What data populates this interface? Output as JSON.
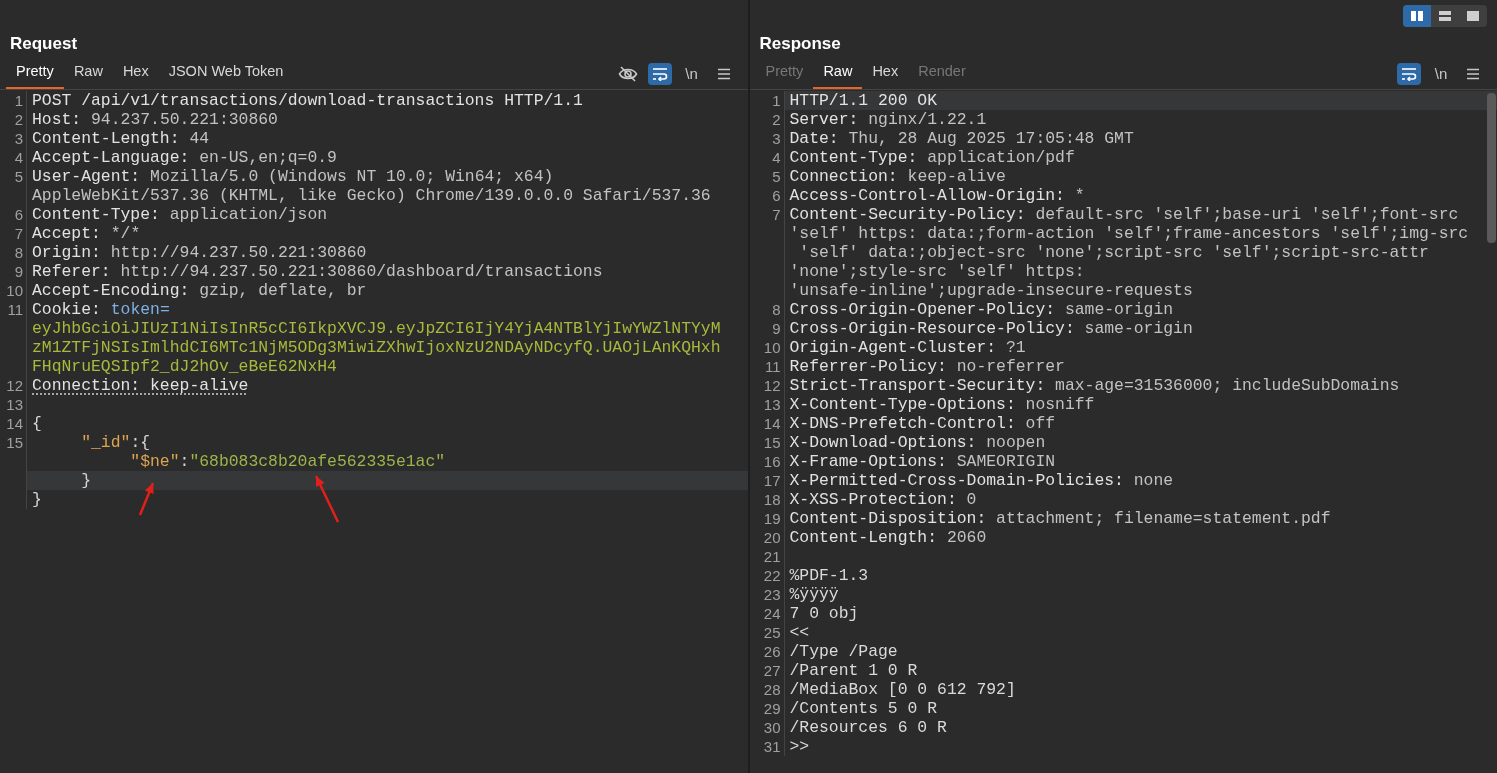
{
  "layout_toggles": [
    {
      "kind": "columns",
      "selected": true
    },
    {
      "kind": "rows",
      "selected": false
    },
    {
      "kind": "single",
      "selected": false
    }
  ],
  "panes": [
    {
      "title": "Request",
      "tabs": [
        {
          "label": "Pretty",
          "selected": true,
          "disabled": false
        },
        {
          "label": "Raw",
          "selected": false,
          "disabled": false
        },
        {
          "label": "Hex",
          "selected": false,
          "disabled": false
        },
        {
          "label": "JSON Web Token",
          "selected": false,
          "disabled": false
        }
      ],
      "toolbar": [
        {
          "kind": "hide",
          "on": false
        },
        {
          "kind": "wrap",
          "on": true
        },
        {
          "kind": "newline",
          "label": "\\n",
          "on": false
        },
        {
          "kind": "menu",
          "on": false
        }
      ],
      "scrollbar": false,
      "rows": [
        {
          "number": "1",
          "highlighted": false,
          "parts": [
            {
              "kind": "name",
              "text": "POST /api/v1/transactions/download-transactions HTTP/1.1"
            }
          ]
        },
        {
          "number": "2",
          "highlighted": false,
          "parts": [
            {
              "kind": "name",
              "text": "Host: "
            },
            {
              "kind": "value",
              "text": "94.237.50.221:30860"
            }
          ]
        },
        {
          "number": "3",
          "highlighted": false,
          "parts": [
            {
              "kind": "name",
              "text": "Content-Length: "
            },
            {
              "kind": "value",
              "text": "44"
            }
          ]
        },
        {
          "number": "4",
          "highlighted": false,
          "parts": [
            {
              "kind": "name",
              "text": "Accept-Language: "
            },
            {
              "kind": "value",
              "text": "en-US,en;q=0.9"
            }
          ]
        },
        {
          "number": "5",
          "highlighted": false,
          "parts": [
            {
              "kind": "name",
              "text": "User-Agent: "
            },
            {
              "kind": "value",
              "text": "Mozilla/5.0 (Windows NT 10.0; Win64; x64)"
            }
          ]
        },
        {
          "highlighted": false,
          "parts": [
            {
              "kind": "value",
              "text": "AppleWebKit/537.36 (KHTML, like Gecko) Chrome/139.0.0.0 Safari/537.36"
            }
          ]
        },
        {
          "number": "6",
          "highlighted": false,
          "parts": [
            {
              "kind": "name",
              "text": "Content-Type: "
            },
            {
              "kind": "value",
              "text": "application/json"
            }
          ]
        },
        {
          "number": "7",
          "highlighted": false,
          "parts": [
            {
              "kind": "name",
              "text": "Accept: "
            },
            {
              "kind": "value",
              "text": "*/*"
            }
          ]
        },
        {
          "number": "8",
          "highlighted": false,
          "parts": [
            {
              "kind": "name",
              "text": "Origin: "
            },
            {
              "kind": "value",
              "text": "http://94.237.50.221:30860"
            }
          ]
        },
        {
          "number": "9",
          "highlighted": false,
          "parts": [
            {
              "kind": "name",
              "text": "Referer: "
            },
            {
              "kind": "value",
              "text": "http://94.237.50.221:30860/dashboard/transactions"
            }
          ]
        },
        {
          "number": "10",
          "highlighted": false,
          "parts": [
            {
              "kind": "name",
              "text": "Accept-Encoding: "
            },
            {
              "kind": "value",
              "text": "gzip, deflate, br"
            }
          ]
        },
        {
          "number": "11",
          "highlighted": false,
          "parts": [
            {
              "kind": "name",
              "text": "Cookie: "
            },
            {
              "kind": "cookie_name",
              "text": "token="
            }
          ]
        },
        {
          "highlighted": false,
          "parts": [
            {
              "kind": "token",
              "text": "eyJhbGciOiJIUzI1NiIsInR5cCI6IkpXVCJ9.eyJpZCI6IjY4YjA4NTBlYjIwYWZlNTYyM"
            }
          ]
        },
        {
          "highlighted": false,
          "parts": [
            {
              "kind": "token",
              "text": "zM1ZTFjNSIsImlhdCI6MTc1NjM5ODg3MiwiZXhwIjoxNzU2NDAyNDcyfQ.UAOjLAnKQHxh"
            }
          ]
        },
        {
          "highlighted": false,
          "parts": [
            {
              "kind": "token",
              "text": "FHqNruEQSIpf2_dJ2hOv_eBeE62NxH4"
            }
          ]
        },
        {
          "number": "12",
          "highlighted": false,
          "parts": [
            {
              "kind": "name_dotted",
              "text": "Connection: keep-alive"
            }
          ]
        },
        {
          "number": "13",
          "highlighted": false,
          "parts": []
        },
        {
          "number": "14",
          "highlighted": false,
          "parts": [
            {
              "kind": "punct",
              "text": "{"
            }
          ]
        },
        {
          "number": "15",
          "highlighted": false,
          "parts": [
            {
              "kind": "json_key",
              "text": "     \"_id\""
            },
            {
              "kind": "punct",
              "text": ":{"
            }
          ]
        },
        {
          "highlighted": false,
          "parts": [
            {
              "kind": "json_key",
              "text": "          \"$ne\""
            },
            {
              "kind": "punct",
              "text": ":"
            },
            {
              "kind": "json_string",
              "text": "\"68b083c8b20afe562335e1ac\""
            }
          ]
        },
        {
          "highlighted": true,
          "parts": [
            {
              "kind": "punct",
              "text": "     }"
            }
          ]
        },
        {
          "highlighted": false,
          "parts": [
            {
              "kind": "punct",
              "text": "}"
            }
          ]
        }
      ]
    },
    {
      "title": "Response",
      "tabs": [
        {
          "label": "Pretty",
          "selected": false,
          "disabled": true
        },
        {
          "label": "Raw",
          "selected": true,
          "disabled": false
        },
        {
          "label": "Hex",
          "selected": false,
          "disabled": false
        },
        {
          "label": "Render",
          "selected": false,
          "disabled": true
        }
      ],
      "toolbar": [
        {
          "kind": "wrap",
          "on": true
        },
        {
          "kind": "newline",
          "label": "\\n",
          "on": false
        },
        {
          "kind": "menu",
          "on": false
        }
      ],
      "scrollbar": true,
      "rows": [
        {
          "number": "1",
          "highlighted": true,
          "parts": [
            {
              "kind": "name",
              "text": "HTTP/1.1 200 OK"
            }
          ]
        },
        {
          "number": "2",
          "highlighted": false,
          "parts": [
            {
              "kind": "name",
              "text": "Server: "
            },
            {
              "kind": "value",
              "text": "nginx/1.22.1"
            }
          ]
        },
        {
          "number": "3",
          "highlighted": false,
          "parts": [
            {
              "kind": "name",
              "text": "Date: "
            },
            {
              "kind": "value",
              "text": "Thu, 28 Aug 2025 17:05:48 GMT"
            }
          ]
        },
        {
          "number": "4",
          "highlighted": false,
          "parts": [
            {
              "kind": "name",
              "text": "Content-Type: "
            },
            {
              "kind": "value",
              "text": "application/pdf"
            }
          ]
        },
        {
          "number": "5",
          "highlighted": false,
          "parts": [
            {
              "kind": "name",
              "text": "Connection: "
            },
            {
              "kind": "value",
              "text": "keep-alive"
            }
          ]
        },
        {
          "number": "6",
          "highlighted": false,
          "parts": [
            {
              "kind": "name",
              "text": "Access-Control-Allow-Origin: "
            },
            {
              "kind": "value",
              "text": "*"
            }
          ]
        },
        {
          "number": "7",
          "highlighted": false,
          "parts": [
            {
              "kind": "name",
              "text": "Content-Security-Policy: "
            },
            {
              "kind": "value",
              "text": "default-src 'self';base-uri 'self';font-src"
            }
          ]
        },
        {
          "highlighted": false,
          "parts": [
            {
              "kind": "value",
              "text": "'self' https: data:;form-action 'self';frame-ancestors 'self';img-src"
            }
          ]
        },
        {
          "highlighted": false,
          "parts": [
            {
              "kind": "value",
              "text": " 'self' data:;object-src 'none';script-src 'self';script-src-attr"
            }
          ]
        },
        {
          "highlighted": false,
          "parts": [
            {
              "kind": "value",
              "text": "'none';style-src 'self' https:"
            }
          ]
        },
        {
          "highlighted": false,
          "parts": [
            {
              "kind": "value",
              "text": "'unsafe-inline';upgrade-insecure-requests"
            }
          ]
        },
        {
          "number": "8",
          "highlighted": false,
          "parts": [
            {
              "kind": "name",
              "text": "Cross-Origin-Opener-Policy: "
            },
            {
              "kind": "value",
              "text": "same-origin"
            }
          ]
        },
        {
          "number": "9",
          "highlighted": false,
          "parts": [
            {
              "kind": "name",
              "text": "Cross-Origin-Resource-Policy: "
            },
            {
              "kind": "value",
              "text": "same-origin"
            }
          ]
        },
        {
          "number": "10",
          "highlighted": false,
          "parts": [
            {
              "kind": "name",
              "text": "Origin-Agent-Cluster: "
            },
            {
              "kind": "value",
              "text": "?1"
            }
          ]
        },
        {
          "number": "11",
          "highlighted": false,
          "parts": [
            {
              "kind": "name",
              "text": "Referrer-Policy: "
            },
            {
              "kind": "value",
              "text": "no-referrer"
            }
          ]
        },
        {
          "number": "12",
          "highlighted": false,
          "parts": [
            {
              "kind": "name",
              "text": "Strict-Transport-Security: "
            },
            {
              "kind": "value",
              "text": "max-age=31536000; includeSubDomains"
            }
          ]
        },
        {
          "number": "13",
          "highlighted": false,
          "parts": [
            {
              "kind": "name",
              "text": "X-Content-Type-Options: "
            },
            {
              "kind": "value",
              "text": "nosniff"
            }
          ]
        },
        {
          "number": "14",
          "highlighted": false,
          "parts": [
            {
              "kind": "name",
              "text": "X-DNS-Prefetch-Control: "
            },
            {
              "kind": "value",
              "text": "off"
            }
          ]
        },
        {
          "number": "15",
          "highlighted": false,
          "parts": [
            {
              "kind": "name",
              "text": "X-Download-Options: "
            },
            {
              "kind": "value",
              "text": "noopen"
            }
          ]
        },
        {
          "number": "16",
          "highlighted": false,
          "parts": [
            {
              "kind": "name",
              "text": "X-Frame-Options: "
            },
            {
              "kind": "value",
              "text": "SAMEORIGIN"
            }
          ]
        },
        {
          "number": "17",
          "highlighted": false,
          "parts": [
            {
              "kind": "name",
              "text": "X-Permitted-Cross-Domain-Policies: "
            },
            {
              "kind": "value",
              "text": "none"
            }
          ]
        },
        {
          "number": "18",
          "highlighted": false,
          "parts": [
            {
              "kind": "name",
              "text": "X-XSS-Protection: "
            },
            {
              "kind": "value",
              "text": "0"
            }
          ]
        },
        {
          "number": "19",
          "highlighted": false,
          "parts": [
            {
              "kind": "name",
              "text": "Content-Disposition: "
            },
            {
              "kind": "value",
              "text": "attachment; filename=statement.pdf"
            }
          ]
        },
        {
          "number": "20",
          "highlighted": false,
          "parts": [
            {
              "kind": "name",
              "text": "Content-Length: "
            },
            {
              "kind": "value",
              "text": "2060"
            }
          ]
        },
        {
          "number": "21",
          "highlighted": false,
          "parts": []
        },
        {
          "number": "22",
          "highlighted": false,
          "parts": [
            {
              "kind": "body",
              "text": "%PDF-1.3"
            }
          ]
        },
        {
          "number": "23",
          "highlighted": false,
          "parts": [
            {
              "kind": "body",
              "text": "%ÿÿÿÿ"
            }
          ]
        },
        {
          "number": "24",
          "highlighted": false,
          "parts": [
            {
              "kind": "body",
              "text": "7 0 obj"
            }
          ]
        },
        {
          "number": "25",
          "highlighted": false,
          "parts": [
            {
              "kind": "body",
              "text": "<<"
            }
          ]
        },
        {
          "number": "26",
          "highlighted": false,
          "parts": [
            {
              "kind": "body",
              "text": "/Type /Page"
            }
          ]
        },
        {
          "number": "27",
          "highlighted": false,
          "parts": [
            {
              "kind": "body",
              "text": "/Parent 1 0 R"
            }
          ]
        },
        {
          "number": "28",
          "highlighted": false,
          "parts": [
            {
              "kind": "body",
              "text": "/MediaBox [0 0 612 792]"
            }
          ]
        },
        {
          "number": "29",
          "highlighted": false,
          "parts": [
            {
              "kind": "body",
              "text": "/Contents 5 0 R"
            }
          ]
        },
        {
          "number": "30",
          "highlighted": false,
          "parts": [
            {
              "kind": "body",
              "text": "/Resources 6 0 R"
            }
          ]
        },
        {
          "number": "31",
          "highlighted": false,
          "parts": [
            {
              "kind": "body",
              "text": ">>"
            }
          ]
        }
      ]
    }
  ]
}
